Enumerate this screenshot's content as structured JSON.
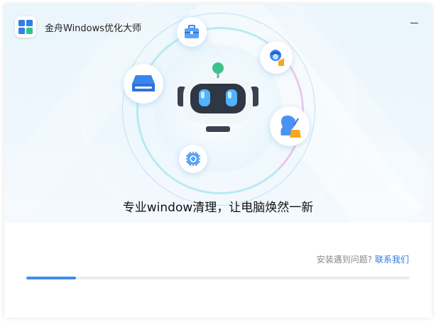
{
  "app": {
    "title": "金舟Windows优化大师"
  },
  "window_controls": {
    "minimize_icon": "minimize-icon"
  },
  "hero": {
    "slogan": "专业window清理，让电脑焕然一新",
    "mascot_icon": "robot-mascot-icon",
    "features": [
      {
        "icon": "disk-drive-icon"
      },
      {
        "icon": "toolbox-icon"
      },
      {
        "icon": "user-clean-icon"
      },
      {
        "icon": "person-broom-icon"
      },
      {
        "icon": "chip-refresh-icon"
      }
    ]
  },
  "footer": {
    "help_text": "安装遇到问题?",
    "contact_link": "联系我们",
    "progress": 0.13
  },
  "colors": {
    "accent": "#3d8fe8",
    "link": "#2a7ae2",
    "hero_bg": "#eaf5fc",
    "mascot_eye": "#4fb3ff",
    "antenna": "#3ec08a"
  }
}
